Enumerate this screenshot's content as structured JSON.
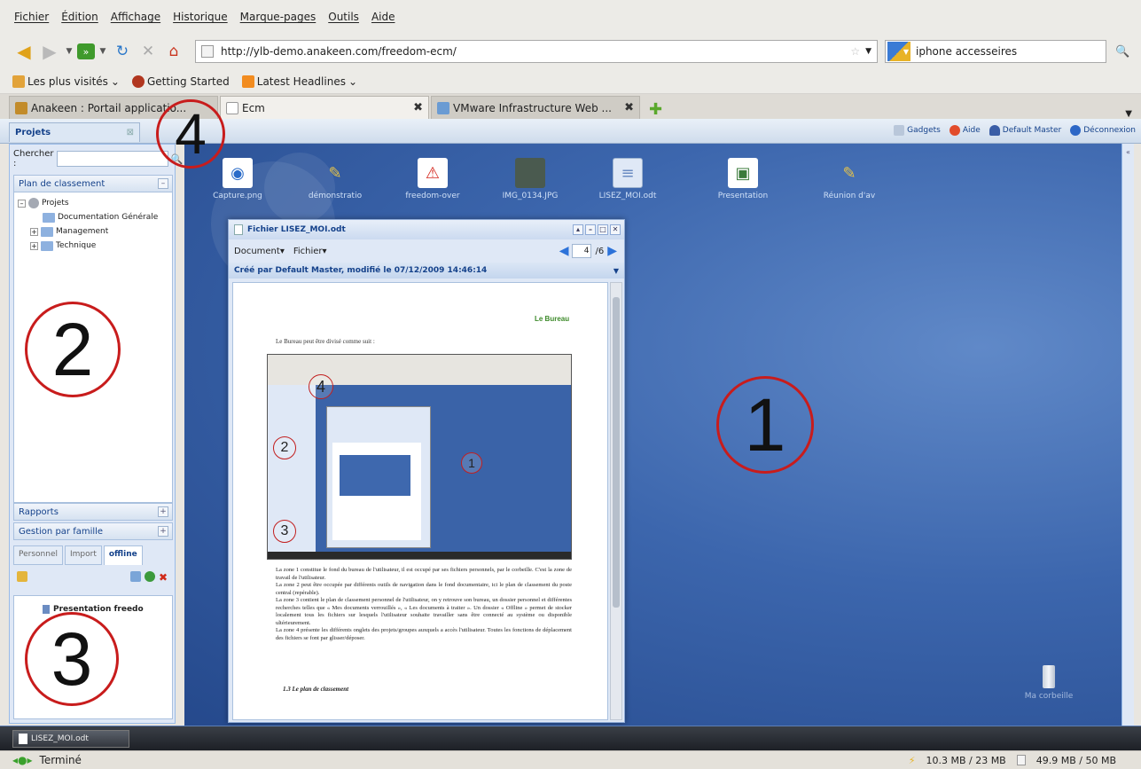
{
  "menu": [
    "Fichier",
    "Édition",
    "Affichage",
    "Historique",
    "Marque-pages",
    "Outils",
    "Aide"
  ],
  "nav": {
    "url": "http://ylb-demo.anakeen.com/freedom-ecm/",
    "search_value": "iphone accesseires"
  },
  "bookmarks": [
    "Les plus visités",
    "Getting Started",
    "Latest Headlines"
  ],
  "tabs": [
    {
      "label": "Anakeen : Portail applicatio..."
    },
    {
      "label": "Ecm"
    },
    {
      "label": "VMware Infrastructure Web ..."
    }
  ],
  "app": {
    "projects_tab": "Projets",
    "toolbar": {
      "gadgets": "Gadgets",
      "help": "Aide",
      "user": "Default Master",
      "logout": "Déconnexion"
    }
  },
  "sidebar": {
    "search_label": "Chercher :",
    "search_value": "",
    "tree_title": "Plan de classement",
    "tree": [
      {
        "label": "Projets"
      },
      {
        "label": "Documentation Générale"
      },
      {
        "label": "Management"
      },
      {
        "label": "Technique"
      }
    ],
    "reports": "Rapports",
    "family": "Gestion par famille",
    "subtabs": [
      "Personnel",
      "Import",
      "offline"
    ],
    "offline_items": [
      "Presentation freedo"
    ]
  },
  "desktop": {
    "icons": [
      {
        "label": "Capture.png",
        "icon": "image-file-icon",
        "color": "#ffffff"
      },
      {
        "label": "démonstratio",
        "icon": "mixed-file-icon",
        "color": "#e6c34a"
      },
      {
        "label": "freedom-over",
        "icon": "pdf-icon",
        "color": "#d4261c"
      },
      {
        "label": "IMG_0134.JPG",
        "icon": "photo-icon",
        "color": "#4a5a4f"
      },
      {
        "label": "LISEZ_MOI.odt",
        "icon": "document-icon",
        "color": "#dfe8f6"
      },
      {
        "label": "Presentation",
        "icon": "presentation-icon",
        "color": "#ffffff"
      },
      {
        "label": "Réunion d'av",
        "icon": "mixed-file-icon",
        "color": "#e6c34a"
      }
    ],
    "trash_label": "Ma corbeille"
  },
  "document_window": {
    "title": "Fichier LISEZ_MOI.odt",
    "menu": [
      "Document",
      "Fichier"
    ],
    "page_value": "4",
    "page_total": "/6",
    "meta": "Créé par Default Master, modifié le 07/12/2009 14:46:14",
    "page": {
      "heading": "Le Bureau",
      "intro": "Le Bureau peut être divisé comme suit :",
      "paragraphs": [
        "La zone 1 constitue le fond du bureau de l'utilisateur, il est occupé par ses fichiers personnels, par le corbeille. C'est la zone de travail de l'utilisateur.",
        "La zone 2 peut être occupée par différents outils de navigation dans le fond documentaire, ici le plan de classement du poste central (repérable).",
        "La zone 3 contient le plan de classement personnel de l'utilisateur, on y retrouve son bureau, un dossier personnel et différentes recherches telles que « Mes documents verrouillés », « Les documents à traiter ». Un dossier « Offline » permet de stocker localement tous les fichiers sur lesquels l'utilisateur souhaite travailler sans être connecté au système ou disponible ultérieurement.",
        "La zone 4 présente les différents onglets des projets/groupes auxquels a accès l'utilisateur. Toutes les fonctions de déplacement des fichiers se font par glisser/déposer."
      ],
      "section": "1.3    Le plan de classement"
    }
  },
  "annotations": [
    "1",
    "2",
    "3",
    "4"
  ],
  "taskbar": {
    "item": "LISEZ_MOI.odt"
  },
  "status": {
    "text": "Terminé",
    "mem1": "10.3 MB / 23 MB",
    "mem2": "49.9 MB / 50 MB"
  },
  "colors": {
    "annotation": "#c81c1c",
    "desktop": "#3c66ad",
    "accent": "#15428b"
  }
}
